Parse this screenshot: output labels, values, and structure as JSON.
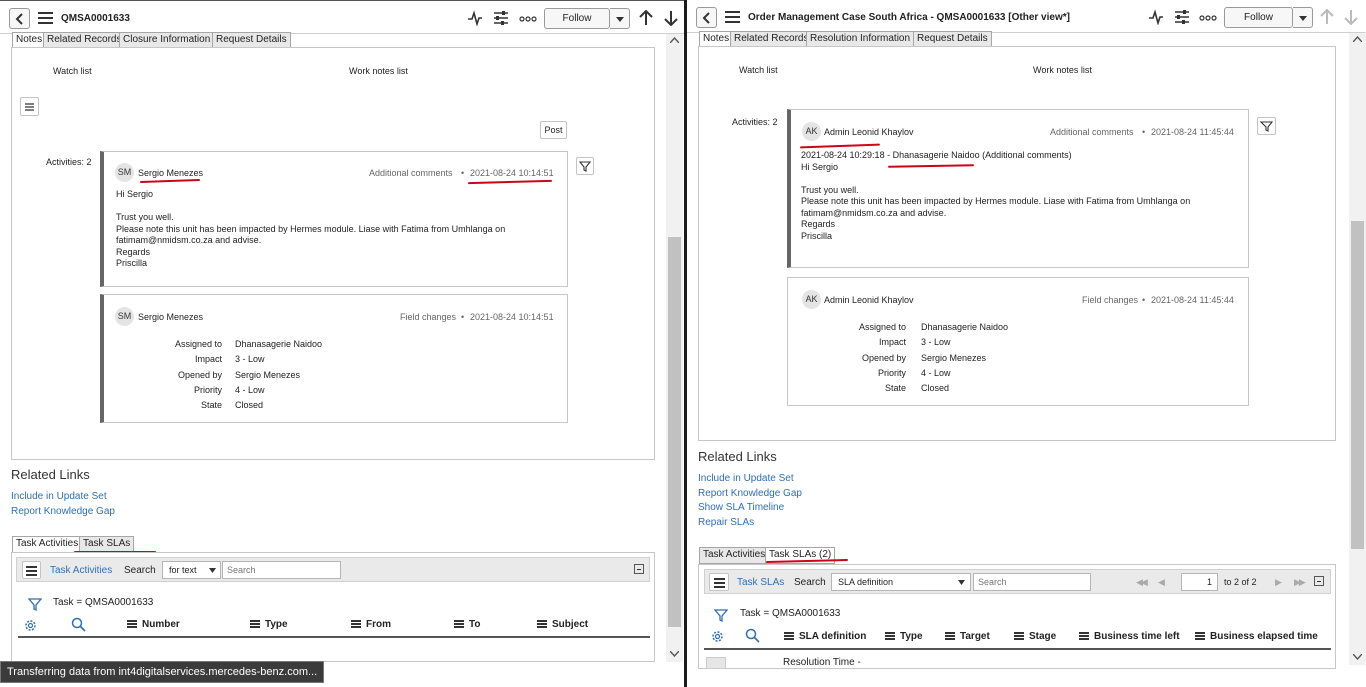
{
  "left": {
    "title": "QMSA0001633",
    "follow_label": "Follow",
    "tabs": [
      "Notes",
      "Related Records",
      "Closure Information",
      "Request Details"
    ],
    "watch_list_label": "Watch list",
    "work_notes_list_label": "Work notes list",
    "post_label": "Post",
    "activities_label": "Activities: 2",
    "entry1": {
      "initials": "SM",
      "author": "Sergio Menezes",
      "kind": "Additional comments",
      "sep": "•",
      "time": "2021-08-24 10:14:51",
      "lines": [
        "Hi Sergio",
        "",
        "Trust you well.",
        "Please note this unit has been impacted by Hermes module. Liase with Fatima from Umhlanga on",
        "fatimam@nmidsm.co.za and advise.",
        "Regards",
        "Priscilla"
      ]
    },
    "entry2": {
      "initials": "SM",
      "author": "Sergio Menezes",
      "kind": "Field changes",
      "sep": "•",
      "time": "2021-08-24 10:14:51",
      "fields": [
        {
          "label": "Assigned to",
          "value": "Dhanasagerie Naidoo"
        },
        {
          "label": "Impact",
          "value": "3 - Low"
        },
        {
          "label": "Opened by",
          "value": "Sergio Menezes"
        },
        {
          "label": "Priority",
          "value": "4 - Low"
        },
        {
          "label": "State",
          "value": "Closed"
        }
      ]
    },
    "related_links_title": "Related Links",
    "related_links": [
      "Include in Update Set",
      "Report Knowledge Gap"
    ],
    "list_tabs": [
      "Task Activities",
      "Task SLAs"
    ],
    "list": {
      "name": "Task Activities",
      "search_label": "Search",
      "search_field": "for text",
      "search_placeholder": "Search",
      "filter": "Task = QMSA0001633",
      "columns": [
        "Number",
        "Type",
        "From",
        "To",
        "Subject"
      ]
    }
  },
  "right": {
    "title": "Order Management Case South Africa - QMSA0001633 [Other view*]",
    "follow_label": "Follow",
    "tabs": [
      "Notes",
      "Related Records",
      "Resolution Information",
      "Request Details"
    ],
    "watch_list_label": "Watch list",
    "work_notes_list_label": "Work notes list",
    "activities_label": "Activities: 2",
    "entry1": {
      "initials": "AK",
      "author": "Admin Leonid Khaylov",
      "kind": "Additional comments",
      "sep": "•",
      "time": "2021-08-24 11:45:44",
      "lines": [
        "2021-08-24 10:29:18 - Dhanasagerie Naidoo (Additional comments)",
        "Hi Sergio",
        "",
        "Trust you well.",
        "Please note this unit has been impacted by Hermes module. Liase with Fatima from Umhlanga on",
        "fatimam@nmidsm.co.za and advise.",
        "Regards",
        "Priscilla"
      ]
    },
    "entry2": {
      "initials": "AK",
      "author": "Admin Leonid Khaylov",
      "kind": "Field changes",
      "sep": "•",
      "time": "2021-08-24 11:45:44",
      "fields": [
        {
          "label": "Assigned to",
          "value": "Dhanasagerie Naidoo"
        },
        {
          "label": "Impact",
          "value": "3 - Low"
        },
        {
          "label": "Opened by",
          "value": "Sergio Menezes"
        },
        {
          "label": "Priority",
          "value": "4 - Low"
        },
        {
          "label": "State",
          "value": "Closed"
        }
      ]
    },
    "related_links_title": "Related Links",
    "related_links": [
      "Include in Update Set",
      "Report Knowledge Gap",
      "Show SLA Timeline",
      "Repair SLAs"
    ],
    "list_tabs": [
      "Task Activities",
      "Task SLAs (2)"
    ],
    "list": {
      "name": "Task SLAs",
      "search_label": "Search",
      "search_field": "SLA definition",
      "search_placeholder": "Search",
      "page_value": "1",
      "page_range": "to 2 of 2",
      "filter": "Task = QMSA0001633",
      "columns": [
        "SLA definition",
        "Type",
        "Target",
        "Stage",
        "Business time left",
        "Business elapsed time"
      ],
      "first_row": "Resolution Time -"
    }
  },
  "status_bar": "Transferring data from int4digitalservices.mercedes-benz.com...",
  "colors": {
    "link": "#2f6fb1",
    "annotation": "#d0021b",
    "card_bar": "#666666"
  },
  "icons": [
    "back-icon",
    "menu-icon",
    "activity-icon",
    "settings-sliders-icon",
    "more-icon",
    "chevron-down-icon",
    "arrow-up-icon",
    "arrow-down-icon",
    "filter-icon",
    "gear-icon",
    "search-icon"
  ]
}
